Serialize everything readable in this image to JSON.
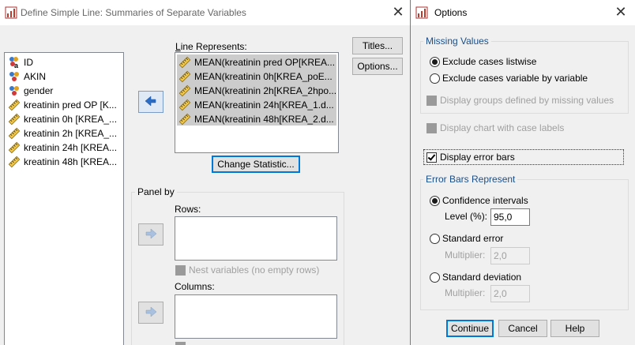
{
  "main_dialog": {
    "title": "Define Simple Line: Summaries of Separate Variables",
    "variables": [
      {
        "label": "ID",
        "icon": "nominal-string-icon"
      },
      {
        "label": "AKIN",
        "icon": "nominal-icon"
      },
      {
        "label": "gender",
        "icon": "nominal-icon"
      },
      {
        "label": "kreatinin pred OP [K...",
        "icon": "scale-icon"
      },
      {
        "label": "kreatinin 0h [KREA_...",
        "icon": "scale-icon"
      },
      {
        "label": "kreatinin 2h [KREA_...",
        "icon": "scale-icon"
      },
      {
        "label": "kreatinin 24h [KREA...",
        "icon": "scale-icon"
      },
      {
        "label": "kreatinin 48h [KREA...",
        "icon": "scale-icon"
      }
    ],
    "line_represents_label": "Line Represents:",
    "line_represents_items": [
      "MEAN(kreatinin pred OP[KREA...",
      "MEAN(kreatinin 0h[KREA_poE...",
      "MEAN(kreatinin 2h[KREA_2hpo...",
      "MEAN(kreatinin 24h[KREA_1.d...",
      "MEAN(kreatinin 48h[KREA_2.d..."
    ],
    "change_statistic": "Change Statistic...",
    "titles_button": "Titles...",
    "options_button": "Options...",
    "panel_by_label": "Panel by",
    "rows_label": "Rows:",
    "nest_label": "Nest variables (no empty rows)",
    "columns_label": "Columns:"
  },
  "options_dialog": {
    "title": "Options",
    "missing_values_label": "Missing Values",
    "exclude_listwise": "Exclude cases listwise",
    "exclude_variable": "Exclude cases variable by variable",
    "display_groups": "Display groups defined by missing values",
    "display_chart_labels": "Display chart with case labels",
    "display_error_bars": "Display error bars",
    "error_bars_label": "Error Bars Represent",
    "confidence_intervals": "Confidence intervals",
    "level_label": "Level (%):",
    "level_value": "95,0",
    "standard_error": "Standard error",
    "multiplier_label": "Multiplier:",
    "se_multiplier": "2,0",
    "standard_deviation": "Standard deviation",
    "sd_multiplier": "2,0",
    "continue_button": "Continue",
    "cancel_button": "Cancel",
    "help_button": "Help"
  }
}
